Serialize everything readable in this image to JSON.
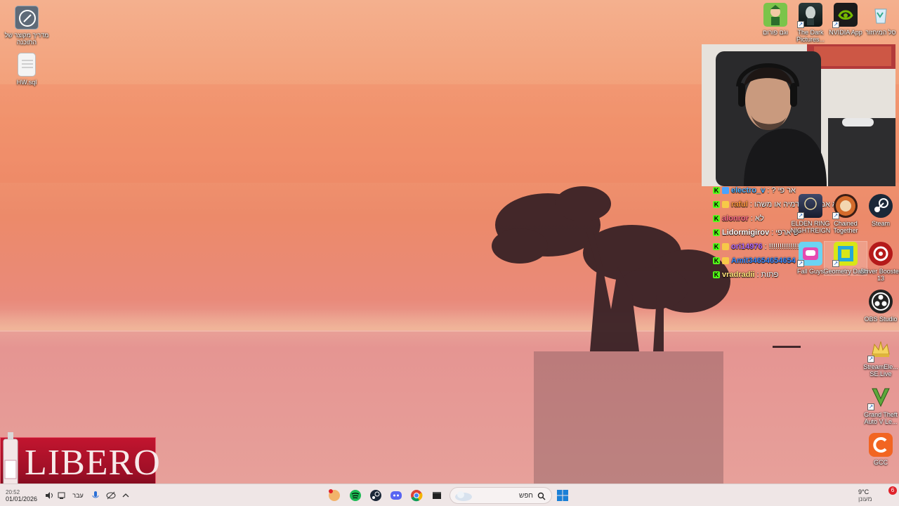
{
  "desktop_left": [
    {
      "label": "מדריך מקוצר של התוכנה"
    },
    {
      "label": "HW.sql"
    }
  ],
  "desktop_top_right": [
    {
      "label": "סל המיחזור"
    },
    {
      "label": "NVIDIA App"
    },
    {
      "label": "The Dark Pictures..."
    },
    {
      "label": "וגם פורום"
    }
  ],
  "desktop_grid": [
    {
      "label": "Steam"
    },
    {
      "label": "Chained Together"
    },
    {
      "label": "ELDEN RING NIGHTREIGN"
    },
    {
      "label": "Driver Booster 13"
    },
    {
      "label": "Geometry Dash"
    },
    {
      "label": "Fall Guys"
    },
    {
      "label": "OBS Studio"
    },
    {
      "label": "StreamEle... SE.Live"
    },
    {
      "label": "Grand Theft Auto V Le..."
    },
    {
      "label": "GCC"
    }
  ],
  "chat": [
    {
      "user": "electro_v",
      "color": "#4fb1ff",
      "message": "? אר פי"
    },
    {
      "user": "raful",
      "color": "#ff9a3c",
      "message": "לא אמרת אקדמיה או משהו"
    },
    {
      "user": "alonror",
      "color": "#ff6b8a",
      "message": "לא"
    },
    {
      "user": "Lidormigirov",
      "color": "#ffffff",
      "message": "יש ארפי"
    },
    {
      "user": "ori14976",
      "color": "#b36bff",
      "message": "!!!!!!!!!!!!!!!!"
    },
    {
      "user": "Amit34654654654",
      "color": "#3a8bff",
      "message": ""
    },
    {
      "user": "vradradii",
      "color": "#ffe27a",
      "message": "פתות"
    }
  ],
  "promo": {
    "brand": "LIBERO"
  },
  "taskbar": {
    "search_placeholder": "חפש",
    "language": "עבר",
    "time": "20:52",
    "date": "01/01/2026",
    "weather_temp": "9°C",
    "weather_desc": "מעונן",
    "notification_count": "6"
  },
  "colors": {
    "kick_green": "#53fc18",
    "taskbar_bg": "#efe6e6"
  }
}
